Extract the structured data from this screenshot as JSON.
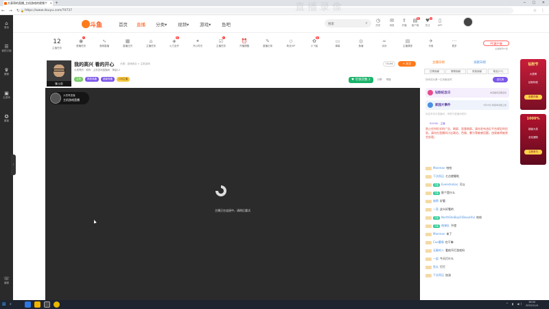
{
  "browser": {
    "tab_title": "大表哥的直播_主机游戏的视频个",
    "url": "https://www.douyu.com/70737",
    "window_controls": "─ □ ✕"
  },
  "watermark": "直播录像",
  "sidebar": {
    "items": [
      {
        "icon": "home-icon",
        "glyph": "⌂",
        "label": "首页"
      },
      {
        "icon": "list-icon",
        "glyph": "☰",
        "label": "我的订阅"
      },
      {
        "icon": "trophy-icon",
        "glyph": "♛",
        "label": "赛程"
      },
      {
        "icon": "gamepad-icon",
        "glyph": "▣",
        "label": "云游戏"
      },
      {
        "icon": "medal-icon",
        "glyph": "✪",
        "label": "赛事"
      },
      {
        "icon": "headset-icon",
        "glyph": "☏",
        "label": "客服"
      }
    ]
  },
  "header": {
    "logo_text": "斗鱼",
    "nav": [
      "首页",
      "直播",
      "分类▾",
      "视频▾",
      "游戏▾",
      "鱼吧"
    ],
    "active_nav": "直播",
    "search_placeholder": "搜索",
    "icons": [
      {
        "name": "history",
        "glyph": "◷",
        "label": "历史"
      },
      {
        "name": "message",
        "glyph": "✉",
        "label": "消息"
      },
      {
        "name": "upload",
        "glyph": "⇪",
        "label": "开播"
      },
      {
        "name": "client",
        "glyph": "▤",
        "label": "客户端",
        "badge": "新"
      },
      {
        "name": "follow",
        "glyph": "♥",
        "label": "关注",
        "badge": "9"
      },
      {
        "name": "app",
        "glyph": "▯",
        "label": "APP"
      }
    ],
    "avatar_badge": "9"
  },
  "tasks": {
    "level": "12",
    "level_label": "主播任务",
    "items": [
      {
        "glyph": "◉",
        "label": "首播任务",
        "badge": "1"
      },
      {
        "glyph": "∿",
        "label": "音频直播"
      },
      {
        "glyph": "▦",
        "label": "直播日历"
      },
      {
        "glyph": "⌂",
        "label": "主播任务"
      },
      {
        "glyph": "◈",
        "label": "火力全开",
        "badge": "新"
      },
      {
        "glyph": "✦",
        "label": "开心时光"
      },
      {
        "glyph": "☑",
        "label": "主播任务",
        "badge": "1"
      },
      {
        "glyph": "⏰",
        "label": "开播提醒"
      },
      {
        "glyph": "✎",
        "label": "直播记录"
      },
      {
        "glyph": "◇",
        "label": "粉丝VIP"
      },
      {
        "glyph": "✿",
        "label": "小飞船",
        "badge": "新"
      },
      {
        "glyph": "▭",
        "label": "弹幕"
      },
      {
        "glyph": "◎",
        "label": "鱼塘"
      },
      {
        "glyph": "∞",
        "label": "派对"
      },
      {
        "glyph": "▤",
        "label": "主播课堂"
      },
      {
        "glyph": "✈",
        "label": "乐鱼"
      },
      {
        "glyph": "···",
        "label": "更多"
      }
    ],
    "pc_client": "PC客户端",
    "pc_client_sub": "主播推荐PC版"
  },
  "room": {
    "title": "我的高兴 看的开心",
    "meta": "分类：游戏综合 > 主机游戏",
    "caption": "播  公告",
    "streamer_line": "大表哥的 · 昵称 · 主机游戏直播间 · 等级12",
    "tags": [
      {
        "text": "主机",
        "bg": "#7c6",
        "fg": "#fff"
      },
      {
        "text": "搞笑风趣",
        "bg": "#7b56e8",
        "fg": "#fff"
      },
      {
        "text": "超级有趣",
        "bg": "#7b56e8",
        "fg": "#fff"
      },
      {
        "text": "LV8主播",
        "bg": "#f5c842",
        "fg": "#7a4a00"
      }
    ],
    "fan_count": "75196",
    "follow_label": "+ 关注",
    "gift_count": "♥ 可领次数 2",
    "share_label": "分享",
    "report_label": "举报"
  },
  "player": {
    "badge_line1": "大表哥直播",
    "badge_line2": "主机游戏直播",
    "loading_message": "主播正在连接中，请稍后重试"
  },
  "right_panel": {
    "rank_title_left": "主播日榜",
    "rank_title_right": "贡献日榜",
    "rank_tabs": [
      "日榜贡献",
      "周榜贡献",
      "贵族贡献",
      "粉丝(17)"
    ],
    "rank_empty": "快来成为第一位贡献者吧",
    "rank_btn": "送礼物",
    "promos": [
      {
        "title": "钻粉纪念日",
        "sub": "本直播间近期活动",
        "icon_color": "#e84a8a",
        "bg": "#f5eefc"
      },
      {
        "title": "家园大事件",
        "sub": "5月19日 新版本功能上线",
        "icon_color": "#4a90e2",
        "bg": "#eef3fc"
      }
    ],
    "chat_notice": "欢迎来到本直播间，请遵守直播间规则",
    "sys_name": "SHOSK · 主播",
    "sys_body": "禁止任何形式的广告、刷屏、恶意刷屏。请勿发布违反平台规定的信息。请勿在直播间讨论政治、色情、暴力等敏感话题。违规者将被禁言处理。",
    "messages": [
      {
        "badge": "",
        "user": "Manman",
        "text": "哈哈"
      },
      {
        "badge": "",
        "user": "下次再见",
        "text": "七点就睡啦"
      },
      {
        "badge": "小鱼",
        "user": "Eveesholsac",
        "text": "可以"
      },
      {
        "badge": "小鱼",
        "user": "",
        "text": "那个是什么"
      },
      {
        "badge": "",
        "user": "她啊",
        "text": "好看"
      },
      {
        "badge": "",
        "user": "一直",
        "text": "这么好看的"
      },
      {
        "badge": "小鱼",
        "user": "NorthSheBoyOrBeautiful",
        "text": "哈哈"
      },
      {
        "badge": "小鱼",
        "user": "炮弹队",
        "text": "不错"
      },
      {
        "badge": "",
        "user": "Manman",
        "text": "来了"
      },
      {
        "badge": "",
        "user": "Cao曹操",
        "text": "在干嘛"
      },
      {
        "badge": "",
        "user": "无聊的人",
        "text": "看他不打游戏吗"
      },
      {
        "badge": "",
        "user": "一起",
        "text": "今天打什么"
      },
      {
        "badge": "",
        "user": "鱼丸",
        "text": "打打"
      },
      {
        "badge": "",
        "user": "下次再见",
        "text": "加油"
      }
    ]
  },
  "ads": [
    {
      "head": "钻粉节",
      "line1": "大表哥",
      "line2": "钻粉特权",
      "pill": "查看详情"
    },
    {
      "head": "1000%",
      "line1": "超级大奖",
      "line2": "全站通知",
      "pill": "立即参与"
    }
  ],
  "os": {
    "start_glyph": "⊞",
    "search_glyph": "⌕",
    "tray": "^ ▮ ◀)",
    "clock_time": "16:00",
    "clock_date": "2022/11/4"
  },
  "colors": {
    "accent": "#ff7a1a",
    "player_bg": "#2b2b2b",
    "sidebar_bg": "#2a2a2a"
  }
}
